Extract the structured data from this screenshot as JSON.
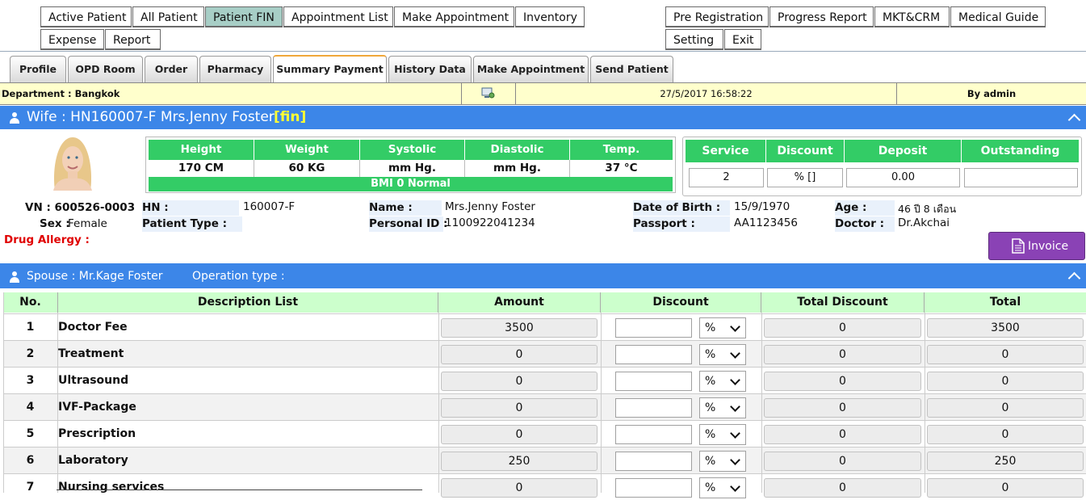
{
  "top_menu": {
    "left_row1": [
      "Active Patient",
      "All Patient",
      "Patient FIN",
      "Appointment List",
      "Make Appointment",
      "Inventory"
    ],
    "left_row2": [
      "Expense",
      "Report"
    ],
    "right_row1": [
      "Pre Registration",
      "Progress Report",
      "MKT&CRM",
      "Medical Guide"
    ],
    "right_row2": [
      "Setting",
      "Exit"
    ],
    "active": "Patient FIN"
  },
  "tabs": [
    "Profile",
    "OPD Room",
    "Order",
    "Pharmacy",
    "Summary Payment",
    "History Data",
    "Make Appointment",
    "Send Patient"
  ],
  "active_tab": "Summary Payment",
  "info_bar": {
    "department": "Department : Bangkok",
    "datetime": "27/5/2017 16:58:22",
    "by": "By admin"
  },
  "patient_header": {
    "title": "Wife : HN160007-F Mrs.Jenny Foster",
    "tag": "[fin]"
  },
  "vitals": {
    "headers": [
      "Height",
      "Weight",
      "Systolic",
      "Diastolic",
      "Temp."
    ],
    "values": [
      "170 CM",
      "60 KG",
      "mm Hg.",
      "mm Hg.",
      "37 °C"
    ],
    "bmi": "BMI 0   Normal"
  },
  "service_summary": {
    "headers": [
      "Service",
      "Discount",
      "Deposit",
      "Outstanding"
    ],
    "values": [
      "2",
      "% []",
      "0.00",
      ""
    ]
  },
  "patient_info": {
    "vn": "VN : 600526-0003",
    "sex_label": "Sex :",
    "sex_value": "Female",
    "drug_allergy": "Drug Allergy :",
    "hn_label": "HN :",
    "hn_value": "160007-F",
    "patient_type_label": "Patient Type :",
    "patient_type_value": "",
    "name_label": "Name :",
    "name_value": "Mrs.Jenny Foster",
    "personal_id_label": "Personal ID :",
    "personal_id_value": "1100922041234",
    "dob_label": "Date of Birth :",
    "dob_value": "15/9/1970",
    "passport_label": "Passport :",
    "passport_value": "AA1123456",
    "age_label": "Age :",
    "age_value": "46 ปี 8 เดือน",
    "doctor_label": "Doctor :",
    "doctor_value": "Dr.Akchai"
  },
  "invoice_button": "Invoice",
  "spouse_bar": {
    "spouse": "Spouse : Mr.Kage Foster",
    "operation": "Operation type :"
  },
  "table": {
    "headers": [
      "No.",
      "Description List",
      "Amount",
      "Discount",
      "Total Discount",
      "Total"
    ],
    "discount_unit": "%",
    "rows": [
      {
        "no": "1",
        "desc": "Doctor Fee",
        "amount": "3500",
        "total_discount": "0",
        "total": "3500"
      },
      {
        "no": "2",
        "desc": "Treatment",
        "amount": "0",
        "total_discount": "0",
        "total": "0"
      },
      {
        "no": "3",
        "desc": "Ultrasound",
        "amount": "0",
        "total_discount": "0",
        "total": "0"
      },
      {
        "no": "4",
        "desc": "IVF-Package",
        "amount": "0",
        "total_discount": "0",
        "total": "0"
      },
      {
        "no": "5",
        "desc": "Prescription",
        "amount": "0",
        "total_discount": "0",
        "total": "0"
      },
      {
        "no": "6",
        "desc": "Laboratory",
        "amount": "250",
        "total_discount": "0",
        "total": "250"
      },
      {
        "no": "7",
        "desc": "Nursing services",
        "amount": "0",
        "total_discount": "0",
        "total": "0"
      }
    ]
  },
  "colors": {
    "blue_bar": "#3c86e8",
    "green_header": "#33cc66",
    "active_menu": "#a7cec6",
    "info_bar": "#ffffcc",
    "invoice": "#8a42b5",
    "allergy_text": "#e00000",
    "fin_tag": "#ffff33"
  }
}
